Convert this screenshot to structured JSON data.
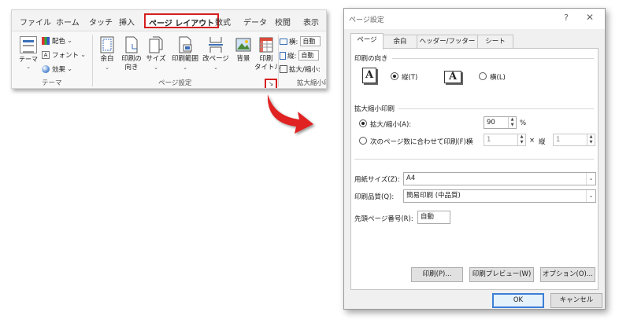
{
  "ribbon": {
    "tabs": [
      "ファイル",
      "ホーム",
      "タッチ",
      "挿入",
      "ページ レイアウト",
      "数式",
      "データ",
      "校閲",
      "表示"
    ],
    "theme": {
      "label": "テーマ",
      "colors": "配色",
      "fonts": "フォント",
      "effects": "効果",
      "group_label": "テーマ"
    },
    "page_setup": {
      "margins": "余白",
      "orientation_l1": "印刷の",
      "orientation_l2": "向き",
      "size": "サイズ",
      "print_area": "印刷範囲",
      "breaks": "改ページ",
      "background": "背景",
      "print_titles_l1": "印刷",
      "print_titles_l2": "タイトル",
      "group_label": "ページ設定",
      "launcher_glyph": "↘"
    },
    "scale": {
      "width_label": "横:",
      "width_value": "自動",
      "height_label": "縦:",
      "height_value": "自動",
      "scale_label": "拡大/縮小:",
      "group_label": "拡大縮小印"
    }
  },
  "dialog": {
    "title": "ページ設定",
    "help": "?",
    "close": "✕",
    "tabs": [
      "ページ",
      "余白",
      "ヘッダー/フッター",
      "シート"
    ],
    "orientation": {
      "title": "印刷の向き",
      "portrait": "縦(T)",
      "landscape": "横(L)",
      "icon_letter": "A"
    },
    "scaling": {
      "title": "拡大縮小印刷",
      "adjust_label": "拡大/縮小(A):",
      "adjust_value": "90",
      "percent": "%",
      "fit_label": "次のページ数に合わせて印刷(F):",
      "wide_label": "横",
      "wide_value": "1",
      "times": "×",
      "tall_label": "縦",
      "tall_value": "1"
    },
    "paper_size": {
      "label": "用紙サイズ(Z):",
      "value": "A4"
    },
    "print_quality": {
      "label": "印刷品質(Q):",
      "value": "簡易印刷 (中品質)"
    },
    "first_page": {
      "label": "先頭ページ番号(R):",
      "value": "自動"
    },
    "buttons": {
      "print": "印刷(P)...",
      "preview": "印刷プレビュー(W)",
      "options": "オプション(O)...",
      "ok": "OK",
      "cancel": "キャンセル"
    }
  },
  "colors": {
    "highlight": "#d61f1f",
    "accent": "#3c7fd6"
  }
}
